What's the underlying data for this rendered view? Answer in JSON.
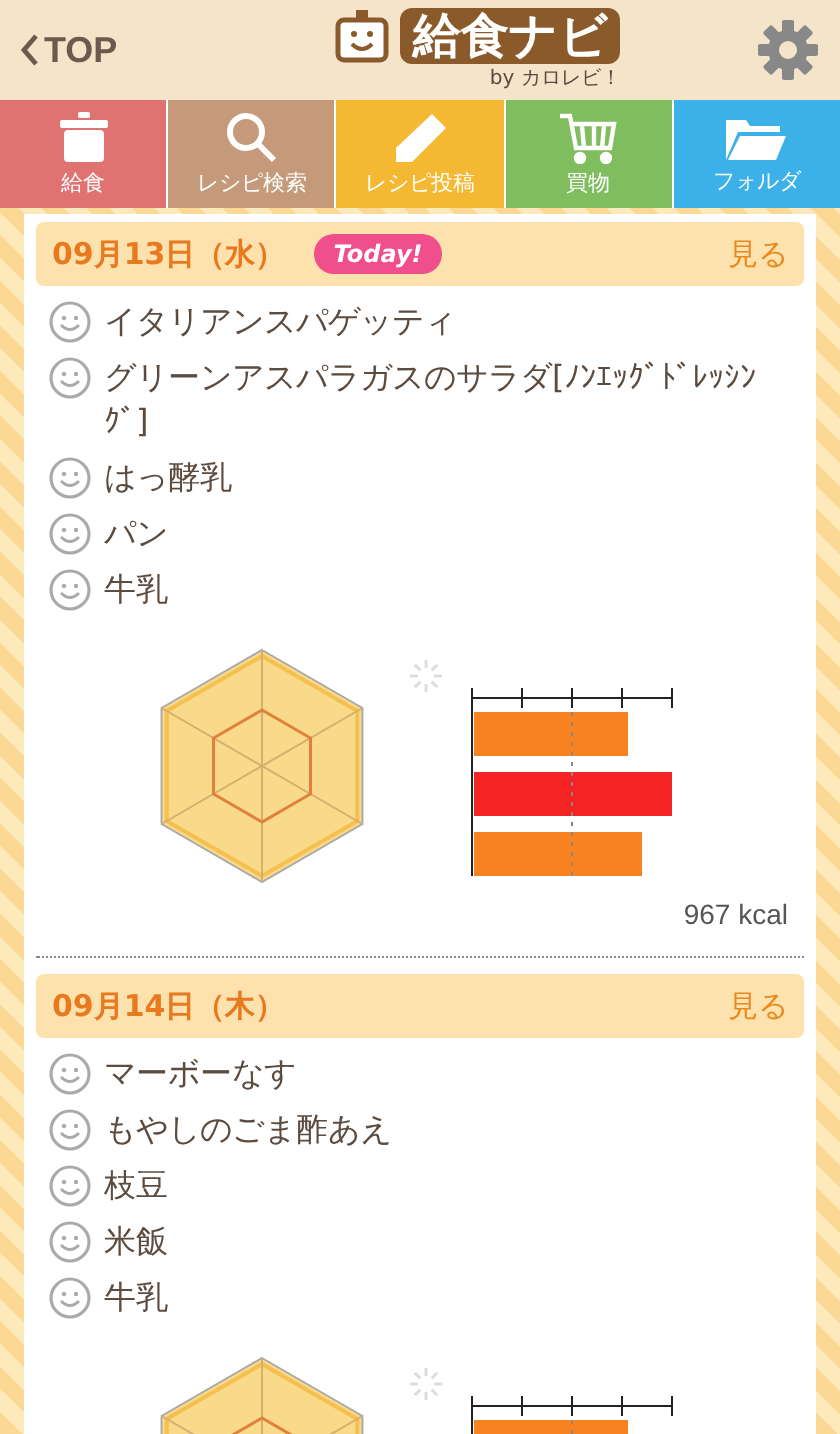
{
  "header": {
    "back": "TOP",
    "logo": "給食ナビ",
    "byline": "by カロレビ！"
  },
  "tabs": [
    {
      "label": "給食",
      "color": "#e07272"
    },
    {
      "label": "レシピ検索",
      "color": "#c49a7a"
    },
    {
      "label": "レシピ投稿",
      "color": "#f5b833"
    },
    {
      "label": "買物",
      "color": "#7fbd5e"
    },
    {
      "label": "フォルダ",
      "color": "#3cb0e8"
    }
  ],
  "days": [
    {
      "date": "09月13日（水）",
      "badge": "Today!",
      "link": "見る",
      "items": [
        "イタリアンスパゲッティ",
        "グリーンアスパラガスのサラダ[ﾉﾝｴｯｸﾞﾄﾞﾚｯｼﾝｸﾞ]",
        "はっ酵乳",
        "パン",
        "牛乳"
      ],
      "calories": "967 kcal"
    },
    {
      "date": "09月14日（木）",
      "link": "見る",
      "items": [
        "マーボーなす",
        "もやしのごま酢あえ",
        "枝豆",
        "米飯",
        "牛乳"
      ]
    }
  ]
}
